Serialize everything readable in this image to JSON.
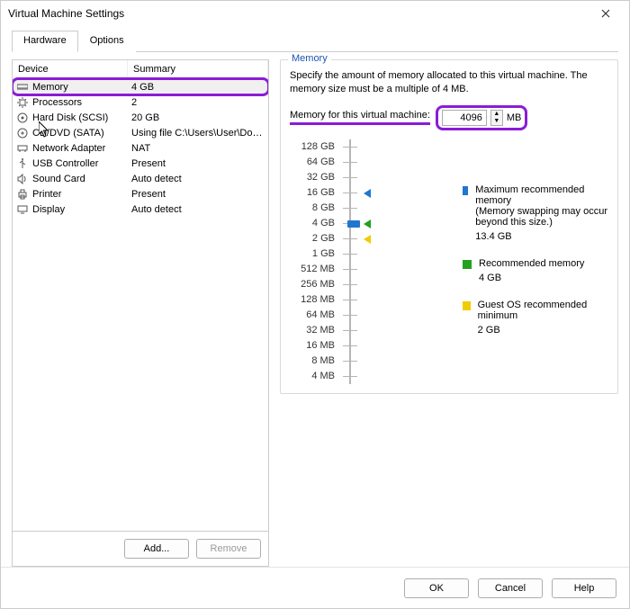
{
  "window": {
    "title": "Virtual Machine Settings"
  },
  "tabs": {
    "hardware": "Hardware",
    "options": "Options",
    "active": "hardware"
  },
  "device_table": {
    "head_device": "Device",
    "head_summary": "Summary",
    "rows": [
      {
        "icon": "memory-icon",
        "name": "Memory",
        "summary": "4 GB",
        "selected": true
      },
      {
        "icon": "cpu-icon",
        "name": "Processors",
        "summary": "2"
      },
      {
        "icon": "disk-icon",
        "name": "Hard Disk (SCSI)",
        "summary": "20 GB"
      },
      {
        "icon": "cd-icon",
        "name": "CD/DVD (SATA)",
        "summary": "Using file C:\\Users\\User\\Dow..."
      },
      {
        "icon": "net-icon",
        "name": "Network Adapter",
        "summary": "NAT"
      },
      {
        "icon": "usb-icon",
        "name": "USB Controller",
        "summary": "Present"
      },
      {
        "icon": "sound-icon",
        "name": "Sound Card",
        "summary": "Auto detect"
      },
      {
        "icon": "printer-icon",
        "name": "Printer",
        "summary": "Present"
      },
      {
        "icon": "display-icon",
        "name": "Display",
        "summary": "Auto detect"
      }
    ],
    "add_label": "Add...",
    "remove_label": "Remove"
  },
  "memory_panel": {
    "group_title": "Memory",
    "description": "Specify the amount of memory allocated to this virtual machine. The memory size must be a multiple of 4 MB.",
    "input_label": "Memory for this virtual machine:",
    "value": "4096",
    "unit": "MB",
    "scale_ticks": [
      "128 GB",
      "64 GB",
      "32 GB",
      "16 GB",
      "8 GB",
      "4 GB",
      "2 GB",
      "1 GB",
      "512 MB",
      "256 MB",
      "128 MB",
      "64 MB",
      "32 MB",
      "16 MB",
      "8 MB",
      "4 MB"
    ],
    "legend": {
      "max": {
        "label": "Maximum recommended memory",
        "sub": "(Memory swapping may occur beyond this size.)",
        "value": "13.4 GB",
        "color": "#1f77d0"
      },
      "rec": {
        "label": "Recommended memory",
        "value": "4 GB",
        "color": "#23a11f"
      },
      "min": {
        "label": "Guest OS recommended minimum",
        "value": "2 GB",
        "color": "#f0cc00"
      }
    }
  },
  "footer": {
    "ok": "OK",
    "cancel": "Cancel",
    "help": "Help"
  }
}
